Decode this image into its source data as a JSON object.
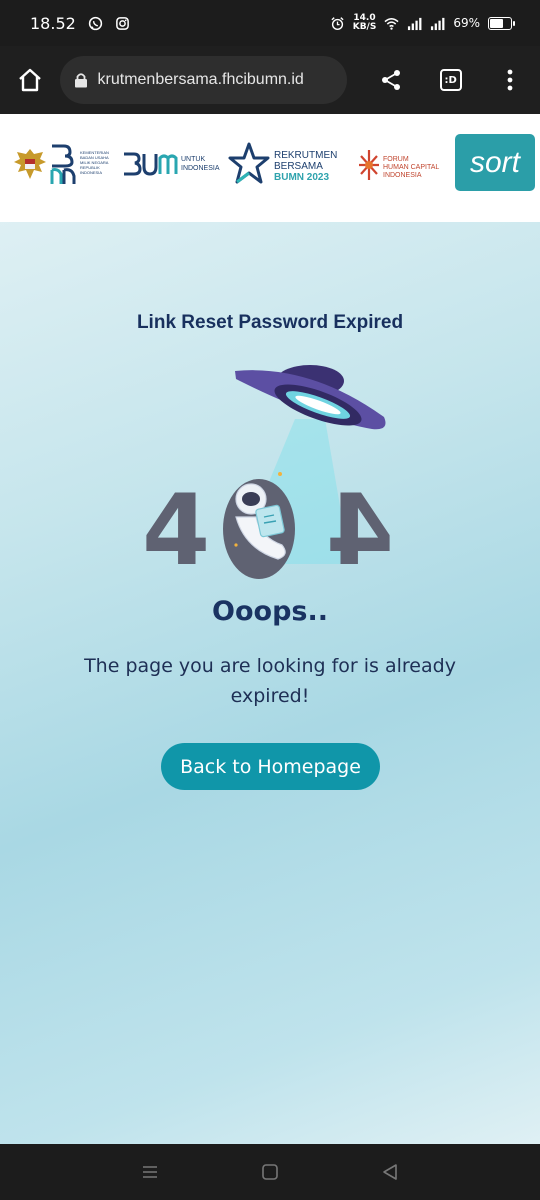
{
  "status_bar": {
    "time": "18.52",
    "net_speed_value": "14.0",
    "net_speed_unit": "KB/S",
    "battery_percent": "69%",
    "battery_level": 0.69,
    "icons": [
      "whatsapp-icon",
      "instagram-icon",
      "alarm-icon",
      "wifi-icon",
      "signal-icon",
      "signal-icon",
      "battery-icon"
    ]
  },
  "browser": {
    "url": "krutmenbersama.fhcibumn.id",
    "tab_label": ":D",
    "icons": [
      "home-icon",
      "lock-icon",
      "share-icon",
      "tab-switcher-icon",
      "more-vert-icon"
    ]
  },
  "logos": {
    "kementerian_text": "KEMENTERIAN BADAN USAHA MILIK NEGARA REPUBLIK INDONESIA",
    "bumn_untuk": "UNTUK",
    "bumn_indonesia": "INDONESIA",
    "rekrutmen_line1": "REKRUTMEN",
    "rekrutmen_line2": "BERSAMA",
    "rekrutmen_line3": "BUMN 2023",
    "forum_line1": "FORUM",
    "forum_line2": "HUMAN CAPITAL",
    "forum_line3": "INDONESIA",
    "sort_label": "sort"
  },
  "main": {
    "heading": "Link Reset Password Expired",
    "error_code": "404",
    "oops": "Ooops..",
    "message": "The page you are looking for is already expired!",
    "home_button": "Back to Homepage"
  },
  "colors": {
    "accent": "#1096a9",
    "heading": "#18305e",
    "digits": "#5f6272",
    "ufo": "#5a4e9e"
  },
  "nav_bar": {
    "icons": [
      "recents-icon",
      "home-square-icon",
      "back-triangle-icon"
    ]
  }
}
